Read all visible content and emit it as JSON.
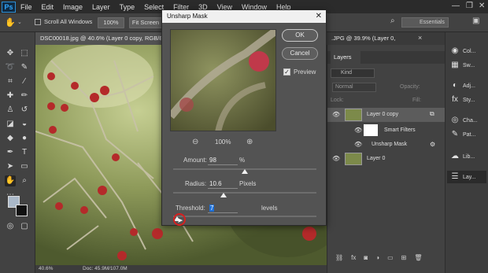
{
  "menubar": {
    "logo": "Ps",
    "items": [
      "File",
      "Edit",
      "Image",
      "Layer",
      "Type",
      "Select",
      "Filter",
      "3D",
      "View",
      "Window",
      "Help"
    ]
  },
  "options": {
    "scroll_all_windows": "Scroll All Windows",
    "zoom_pct": "100%",
    "fit_screen": "Fit Screen",
    "workspace": "Essentials"
  },
  "tabs": {
    "active": "DSC00018.jpg @ 40.6% (Layer 0 copy, RGB/8",
    "other": ".JPG @ 39.9% (Layer 0, "
  },
  "dialog": {
    "title": "Unsharp Mask",
    "ok": "OK",
    "cancel": "Cancel",
    "preview_label": "Preview",
    "preview_checked": true,
    "zoom": "100%",
    "amount_label": "Amount:",
    "amount_value": "98",
    "amount_unit": "%",
    "amount_level": 0.5,
    "radius_label": "Radius:",
    "radius_value": "10.6",
    "radius_unit": "Pixels",
    "radius_level": 0.35,
    "threshold_label": "Threshold:",
    "threshold_value": "7",
    "threshold_unit": "levels",
    "threshold_level": 0.03
  },
  "layers": {
    "title": "Layers",
    "kind": "Kind",
    "blend": "Normal",
    "opacity_label": "Opacity:",
    "lock_label": "Lock:",
    "fill_label": "Fill:",
    "rows": {
      "copy": "Layer 0 copy",
      "smart_filters": "Smart Filters",
      "unsharp": "Unsharp Mask",
      "base": "Layer 0"
    }
  },
  "panel_strip": [
    "Col...",
    "Sw...",
    "Adj...",
    "Sty...",
    "Cha...",
    "Pat...",
    "Lib...",
    "Lay..."
  ],
  "status": {
    "zoom": "40.6%",
    "doc": "Doc: 45.9M/107.0M"
  },
  "colors": {
    "accent": "#31a8ff",
    "panel": "#424242",
    "menubar": "#2b2b2b",
    "highlight_ring": "#d62020"
  }
}
